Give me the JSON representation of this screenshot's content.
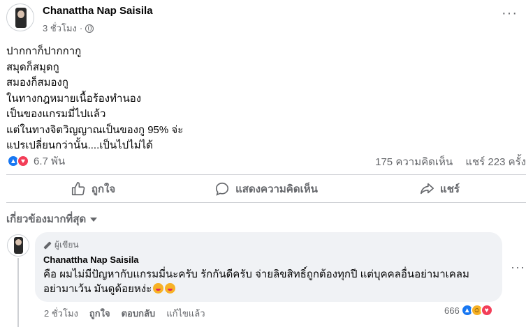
{
  "post": {
    "author": "Chanattha Nap Saisila",
    "time": "3 ชั่วโมง",
    "separator": "·",
    "more_glyph": "···",
    "lines": [
      "ปากกาก็ปากกากู",
      "สมุดก็สมุดกู",
      "สมองก็สมองกู",
      "ในทางกฎหมายเนื้อร้องทำนอง",
      "เป็นของแกรมมี่ไปแล้ว",
      "แต่ในทางจิตวิญญาณเป็นของกู 95% จ่ะ",
      "แปรเปลี่ยนกว่านั้น....เป็นไปไม่ได้"
    ],
    "reaction_count": "6.7 พัน",
    "comments_count": "175 ความคิดเห็น",
    "shares_count": "แชร์ 223 ครั้ง"
  },
  "actions": {
    "like": "ถูกใจ",
    "comment": "แสดงความคิดเห็น",
    "share": "แชร์"
  },
  "comments_sort": "เกี่ยวข้องมากที่สุด",
  "comment": {
    "badge": "ผู้เขียน",
    "author": "Chanattha Nap Saisila",
    "line1": "คือ ผมไม่มีปัญหากับแกรมมี่นะครับ รักกันดีครับ จ่ายลิขสิทธิ์ถูกต้องทุกปี แต่บุคคลอื่นอย่ามาเคลม",
    "line2": "อย่ามาเว้น มันดูด้อยหง่ะ",
    "time": "2 ชั่วโมง",
    "like": "ถูกใจ",
    "reply": "ตอบกลับ",
    "edit": "แก้ไขแล้ว",
    "reaction_count": "666",
    "more_glyph": "···"
  },
  "colors": {
    "like_blue": "#1877f2",
    "love_red": "#f33e58",
    "haha_yellow": "#f7b125",
    "secondary_text": "#65676b",
    "bubble_bg": "#f0f2f5"
  },
  "icons": [
    "globe-icon",
    "like-icon",
    "love-icon",
    "haha-icon",
    "thumbs-up-icon",
    "comment-icon",
    "share-icon",
    "chevron-down-icon",
    "pen-icon",
    "more-icon"
  ]
}
